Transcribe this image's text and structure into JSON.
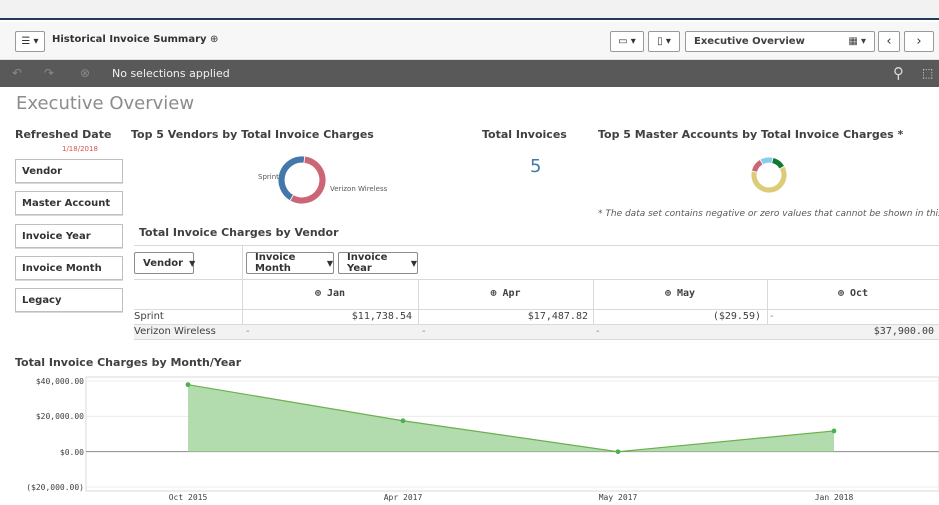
{
  "toolbar": {
    "app_title": "Historical Invoice Summary",
    "sheet_name": "Executive Overview"
  },
  "selections": {
    "status": "No selections applied"
  },
  "sheet": {
    "title": "Executive Overview"
  },
  "refreshed": {
    "label": "Refreshed Date",
    "date": "1/18/2018"
  },
  "filters": [
    {
      "label": "Vendor"
    },
    {
      "label": "Master Account"
    },
    {
      "label": "Invoice Year"
    },
    {
      "label": "Invoice Month"
    },
    {
      "label": "Legacy"
    }
  ],
  "vendors_donut": {
    "title": "Top 5 Vendors by Total Invoice Charges",
    "labels": [
      "Sprint",
      "Verizon Wireless"
    ]
  },
  "kpi": {
    "title": "Total Invoices",
    "value": "5"
  },
  "master_donut": {
    "title": "Top 5 Master Accounts by Total Invoice Charges *",
    "note": "* The data set contains negative or zero values that cannot be shown in this chart."
  },
  "pivot": {
    "title": "Total Invoice Charges by Vendor",
    "row_dim": "Vendor",
    "col_dims": [
      "Invoice Month",
      "Invoice Year"
    ],
    "columns": [
      "Jan",
      "Apr",
      "May",
      "Oct"
    ],
    "rows": [
      {
        "label": "Sprint",
        "values": [
          "$11,738.54",
          "$17,487.82",
          "($29.59)",
          "-"
        ]
      },
      {
        "label": "Verizon Wireless",
        "values": [
          "-",
          "-",
          "-",
          "$37,900.00"
        ]
      }
    ]
  },
  "line_chart": {
    "title": "Total Invoice Charges by Month/Year"
  },
  "chart_data": [
    {
      "type": "pie",
      "title": "Top 5 Vendors by Total Invoice Charges",
      "categories": [
        "Sprint",
        "Verizon Wireless"
      ],
      "values": [
        29196.77,
        37900.0
      ],
      "colors": [
        "#4477aa",
        "#cc6677"
      ]
    },
    {
      "type": "pie",
      "title": "Top 5 Master Accounts by Total Invoice Charges *",
      "categories": [],
      "values": [
        62,
        13,
        12,
        13
      ],
      "colors": [
        "#ddcc77",
        "#cc6677",
        "#88ccee",
        "#117733"
      ]
    },
    {
      "type": "area",
      "title": "Total Invoice Charges by Month/Year",
      "categories": [
        "Oct 2015",
        "Apr 2017",
        "May 2017",
        "Jan 2018"
      ],
      "values": [
        37900.0,
        17487.82,
        -29.59,
        11738.54
      ],
      "ylim": [
        -20000,
        40000
      ],
      "yticks": [
        "$40,000.00",
        "$20,000.00",
        "$0.00",
        "($20,000.00)"
      ],
      "color": "#a6d6a0",
      "line_color": "#6ab04c"
    }
  ]
}
